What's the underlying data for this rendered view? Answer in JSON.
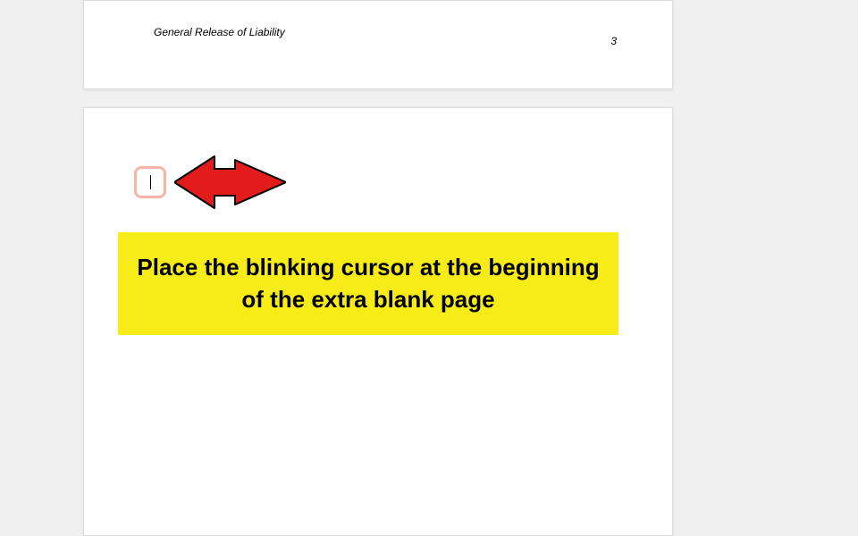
{
  "document": {
    "header_title": "General Release of Liability",
    "page_number": "3"
  },
  "instruction": {
    "text": "Place the blinking cursor at the beginning of the extra blank page"
  }
}
